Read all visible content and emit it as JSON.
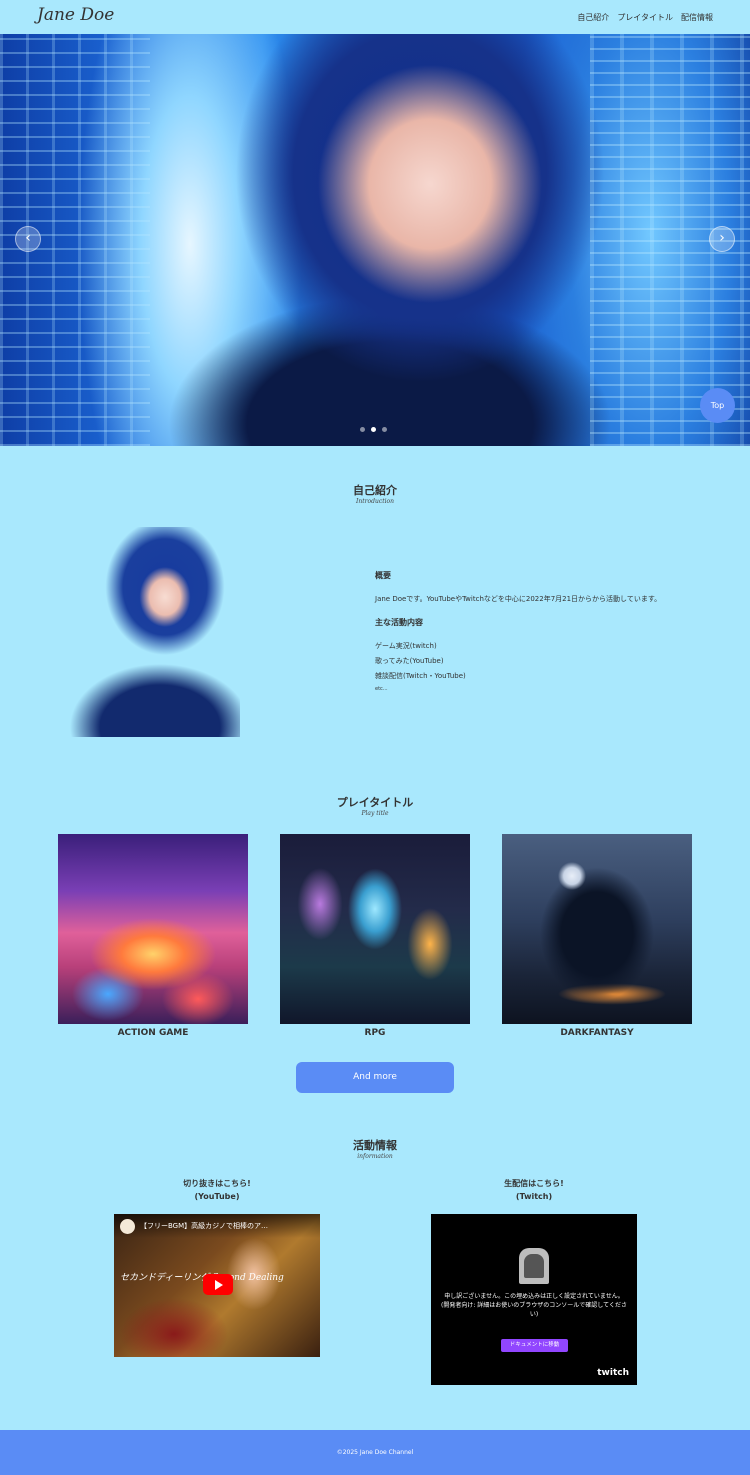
{
  "header": {
    "logo": "Jane Doe",
    "nav": [
      "自己紹介",
      "プレイタイトル",
      "配信情報"
    ]
  },
  "hero": {
    "prev_label": "‹",
    "next_label": "›",
    "dots": 3,
    "active_dot": 1,
    "top_button": "Top"
  },
  "intro": {
    "title": "自己紹介",
    "subtitle": "Introduction",
    "overview_heading": "概要",
    "overview_text": "Jane Doeです。YouTubeやTwitchなどを中心に2022年7月21日からから活動しています。",
    "activities_heading": "主な活動内容",
    "activities": [
      "ゲーム実況(twitch)",
      "歌ってみた(YouTube)",
      "雑談配信(Twitch・YouTube)"
    ],
    "etc": "etc..."
  },
  "play": {
    "title": "プレイタイトル",
    "subtitle": "Play title",
    "games": [
      "ACTION GAME",
      "RPG",
      "DARKFANTASY"
    ],
    "more_button": "And more"
  },
  "activity": {
    "title": "活動情報",
    "subtitle": "information",
    "youtube_label_1": "切り抜きはこちら!",
    "youtube_label_2": "(YouTube)",
    "twitch_label_1": "生配信はこちら!",
    "twitch_label_2": "(Twitch)",
    "youtube_video_title": "【フリーBGM】高級カジノで相棒のア…",
    "youtube_overlay": "セカンドディーリング Second Dealing",
    "twitch_message": "申し訳ございません。この埋め込みは正しく設定されていません。(開発者向け: 詳細はお使いのブラウザのコンソールで確認してください)",
    "twitch_button": "ドキュメントに移動",
    "twitch_logo": "twitch"
  },
  "footer": {
    "copyright": "©2025 Jane Doe Channel"
  }
}
